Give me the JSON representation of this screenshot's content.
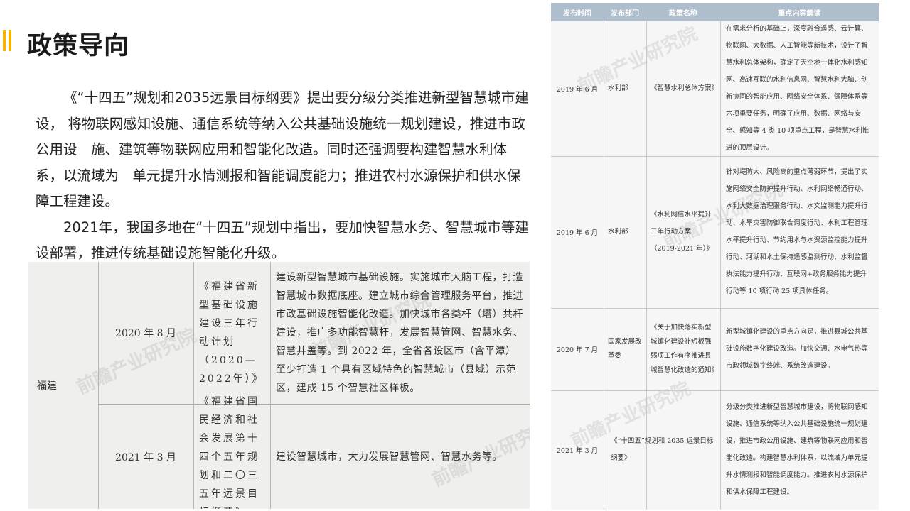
{
  "header": {
    "title": "政策导向",
    "accent_color": "#f4b400"
  },
  "intro": {
    "paragraph1": "《“十四五”规划和2035远景目标纲要》提出要分级分类推进新型智慧城市建设， 将物联网感知设施、通信系统等纳入公共基础设施统一规划建设，推进市政公用设　施、建筑等物联网应用和智能化改造。同时还强调要构建智慧水利体系，以流域为　单元提升水情测报和智能调度能力；推进农村水源保护和供水保障工程建设。",
    "paragraph2": "2021年，我国多地在“十四五”规划中指出，要加快智慧水务、智慧城市等建 设部署，推进传统基础设施智能化升级。"
  },
  "left_table": {
    "province": "福建",
    "rows": [
      {
        "date": "2020 年 8 月",
        "name": "《福建省新型基础设施建设三年行动计划（2020—2022年）》",
        "content": "建设新型智慧城市基础设施。实施城市大脑工程，打造智慧城市数据底座。建立城市综合管理服务平台，推进市政基础设施智能化改造。加快城市各类杆（塔）共杆建设，推广多功能智慧杆，发展智慧管网、智慧水务、智慧井盖等。到 2022 年，全省各设区市（含平潭）至少打造 1 个具有区域特色的智慧城市（县域）示范区，建成 15 个智慧社区样板。"
      },
      {
        "date": "2021 年 3 月",
        "name": "《福建省国民经济和社会发展第十四个五年规划和二〇三五年远景目标纲要》",
        "content": "建设智慧城市，大力发展智慧管网、智慧水务等。"
      }
    ],
    "watermark": "前瞻产业研究院"
  },
  "right_table": {
    "headers": [
      "发布时间",
      "发布部门",
      "政策名称",
      "重点内容解读"
    ],
    "rows": [
      {
        "date": "2019 年 6 月",
        "dept": "水利部",
        "name": "《智慧水利总体方案》",
        "content": "在需求分析的基础上，深度融合遥感、云计算、物联网、大数据、人工智能等新技术，设计了智慧水利总体架构，确定了天空地一体化水利感知网、高速互联的水利信息网、智慧水利大脑、创新协同的智能应用、网络安全体系、保障体系等六项重要任务，明确了应用、数据、网络与安全、感知等 4 类 10 项重点工程，是智慧水利推进的顶层设计。"
      },
      {
        "date": "2019 年 6 月",
        "dept": "水利部",
        "name": "《水利网信水平提升三年行动方案（2019-2021 年）》",
        "content": "针对堤防大、风险高的重点薄弱环节，提出了实施网络安全防护提升行动、水利网络畅通行动、水利大数据治理服务行动、水文监测能力提升行动、水旱灾害防御联合调度行动、水利工程管理水平提升行动、节约用水与水资源监控能力提升行动、河湖和水土保持遥感监测行动、水利监督执法能力提升行动、互联网+政务服务能力提升行动等 10 项行动 25 项具体任务。"
      },
      {
        "date": "2020 年 7 月",
        "dept": "国家发展改革委",
        "name": "《关于加快落实新型城镇化建设补短板强弱项工作有序推进县城智慧化改造的通知》",
        "content": "新型城镇化建设的重点方向是，推进县城公共基础设施数字化建设改造。加快交通、水电气热等市政领域数字终端、系统改造建设。"
      },
      {
        "date": "2021 年 3 月",
        "dept": "",
        "name": "《“十四五”规划和 2035 远景目标纲要》",
        "content": "分级分类推进新型智慧城市建设，将物联网感知设施、通信系统等纳入公共基础设施统一规划建设，推进市政公用设施、建筑等物联网应用和智能化改造。构建智慧水利体系，以流域为单元提升水情测报和智能调度能力。推进农村水源保护和供水保障工程建设。"
      }
    ],
    "watermark": "前瞻产业研究院"
  }
}
